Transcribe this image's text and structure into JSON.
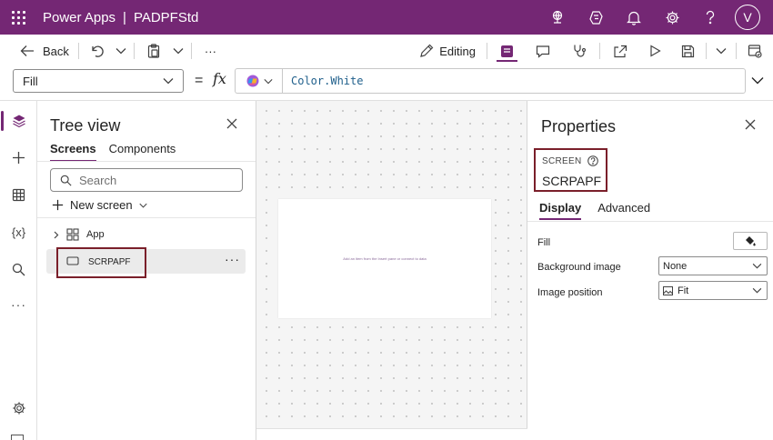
{
  "header": {
    "app_name": "Power Apps",
    "separator": "|",
    "app_title": "PADPFStd",
    "avatar_initial": "V",
    "icons": [
      "environment-icon",
      "copilot-hub-icon",
      "notification-bell-icon",
      "settings-gear-icon",
      "help-icon"
    ]
  },
  "toolbar": {
    "back_label": "Back",
    "more_label": "···",
    "editing_label": "Editing"
  },
  "formula": {
    "property": "Fill",
    "equals": "=",
    "fx": "fx",
    "expression": "Color.White"
  },
  "tree": {
    "title": "Tree view",
    "tabs": [
      "Screens",
      "Components"
    ],
    "search_placeholder": "Search",
    "new_screen_label": "New screen",
    "app_node": "App",
    "screen_node": "SCRPAPF",
    "screen_more": "···"
  },
  "canvas": {
    "hint": "Add an item from the Insert pane or connect to data"
  },
  "properties": {
    "title": "Properties",
    "type_label": "SCREEN",
    "screen_name": "SCRPAPF",
    "tabs": [
      "Display",
      "Advanced"
    ],
    "fill_label": "Fill",
    "background_image_label": "Background image",
    "background_image_value": "None",
    "image_position_label": "Image position",
    "image_position_value": "Fit"
  },
  "colors": {
    "brand": "#742774",
    "highlight_box": "#7a1f2a",
    "formula_text": "#1f5f8b"
  }
}
